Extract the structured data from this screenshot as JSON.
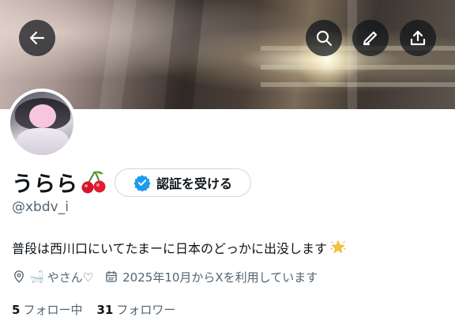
{
  "header": {
    "back_icon": "arrow-left-icon",
    "search_icon": "search-icon",
    "edit_icon": "pencil-icon",
    "share_icon": "share-upload-icon",
    "overlay_color": "#0f1419"
  },
  "profile": {
    "display_name": "うらら",
    "name_emoji": "cherry-emoji",
    "handle": "@xbdv_i",
    "verify_button_label": "認証を受ける",
    "verify_icon": "verified-badge-icon",
    "verify_color": "#1d9bf0",
    "bio": "普段は西川口にいてたまーに日本のどっかに出没します",
    "bio_emoji": "glowing-star-emoji",
    "location_icon": "location-pin-icon",
    "location_emoji": "🛁",
    "location_text": "やさん♡",
    "calendar_icon": "calendar-icon",
    "joined": "2025年10月からXを利用しています",
    "following_count": "5",
    "following_label": "フォロー中",
    "followers_count": "31",
    "followers_label": "フォロワー"
  },
  "colors": {
    "text_primary": "#0f1419",
    "text_secondary": "#536471",
    "border": "#cfd9de"
  }
}
